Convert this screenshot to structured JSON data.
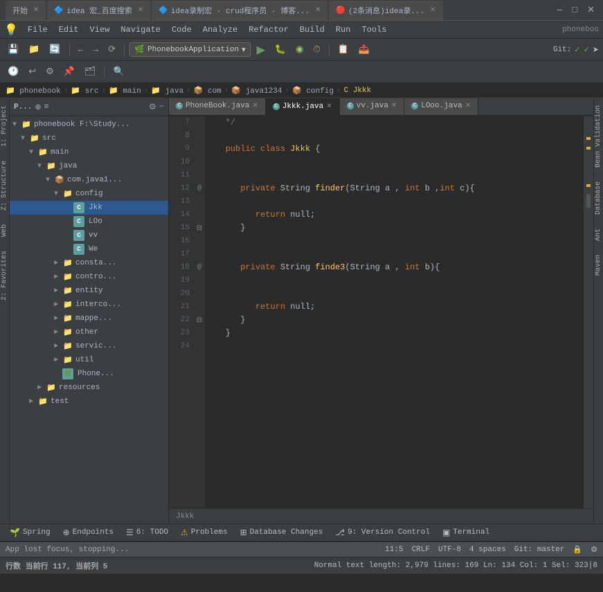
{
  "titlebar": {
    "tabs": [
      {
        "label": "开始",
        "active": false
      },
      {
        "label": "idea 宏_百度搜索",
        "active": false
      },
      {
        "label": "idea录制宏 - crud程序员 - 博客...",
        "active": false
      },
      {
        "label": "(2条消息)idea录...",
        "active": false
      }
    ],
    "controls": [
      "—",
      "□",
      "✕"
    ]
  },
  "menubar": {
    "items": [
      "File",
      "Edit",
      "View",
      "Navigate",
      "Code",
      "Analyze",
      "Refactor",
      "Build",
      "Run",
      "Tools"
    ],
    "appname": "phoneboo"
  },
  "toolbar": {
    "project_dropdown": "PhonebookApplication",
    "git_label": "Git:",
    "git_check": "✓",
    "git_check2": "✓"
  },
  "breadcrumb": {
    "items": [
      "phonebook",
      "src",
      "main",
      "java",
      "com",
      "java1234",
      "config",
      "Jkkk"
    ]
  },
  "project_panel": {
    "title": "P...",
    "tree": [
      {
        "label": "phonebook  F:\\Study...",
        "level": 0,
        "type": "project",
        "expanded": true
      },
      {
        "label": "src",
        "level": 1,
        "type": "folder",
        "expanded": true
      },
      {
        "label": "main",
        "level": 2,
        "type": "folder",
        "expanded": true
      },
      {
        "label": "java",
        "level": 3,
        "type": "folder",
        "expanded": true
      },
      {
        "label": "com.java1...",
        "level": 4,
        "type": "package",
        "expanded": true
      },
      {
        "label": "config",
        "level": 5,
        "type": "folder",
        "expanded": true
      },
      {
        "label": "Jkk",
        "level": 6,
        "type": "java",
        "selected": true
      },
      {
        "label": "LOo",
        "level": 6,
        "type": "java"
      },
      {
        "label": "vv",
        "level": 6,
        "type": "java"
      },
      {
        "label": "We",
        "level": 6,
        "type": "java"
      },
      {
        "label": "consta...",
        "level": 5,
        "type": "folder",
        "collapsed": true
      },
      {
        "label": "contro...",
        "level": 5,
        "type": "folder",
        "collapsed": true
      },
      {
        "label": "entity",
        "level": 5,
        "type": "folder",
        "collapsed": true
      },
      {
        "label": "interco...",
        "level": 5,
        "type": "folder",
        "collapsed": true
      },
      {
        "label": "mappe...",
        "level": 5,
        "type": "folder",
        "collapsed": true
      },
      {
        "label": "other",
        "level": 5,
        "type": "folder",
        "collapsed": true
      },
      {
        "label": "servic...",
        "level": 5,
        "type": "folder",
        "collapsed": true
      },
      {
        "label": "util",
        "level": 5,
        "type": "folder",
        "collapsed": true
      },
      {
        "label": "Phone...",
        "level": 5,
        "type": "java"
      },
      {
        "label": "resources",
        "level": 3,
        "type": "folder",
        "collapsed": true
      },
      {
        "label": "test",
        "level": 2,
        "type": "folder",
        "collapsed": true
      }
    ]
  },
  "editor": {
    "tabs": [
      {
        "label": "PhoneBook.java",
        "active": false
      },
      {
        "label": "Jkkk.java",
        "active": true
      },
      {
        "label": "vv.java",
        "active": false
      },
      {
        "label": "LOoo.java",
        "active": false
      }
    ],
    "filename": "Jkkk",
    "lines": [
      {
        "num": 7,
        "code": "   */",
        "type": "comment"
      },
      {
        "num": 8,
        "code": ""
      },
      {
        "num": 9,
        "code": "   public class Jkkk {",
        "type": "class"
      },
      {
        "num": 10,
        "code": ""
      },
      {
        "num": 11,
        "code": ""
      },
      {
        "num": 12,
        "code": "      private String finder(String a , int b ,int c){",
        "type": "method"
      },
      {
        "num": 13,
        "code": ""
      },
      {
        "num": 14,
        "code": "         return null;",
        "type": "return"
      },
      {
        "num": 15,
        "code": "      }"
      },
      {
        "num": 16,
        "code": ""
      },
      {
        "num": 17,
        "code": ""
      },
      {
        "num": 18,
        "code": "      private String finde3(String a , int b){",
        "type": "method"
      },
      {
        "num": 19,
        "code": ""
      },
      {
        "num": 20,
        "code": ""
      },
      {
        "num": 21,
        "code": "         return null;",
        "type": "return"
      },
      {
        "num": 22,
        "code": "      }"
      },
      {
        "num": 23,
        "code": "   }"
      },
      {
        "num": 24,
        "code": ""
      }
    ]
  },
  "bottom_tabs": [
    {
      "label": "Spring",
      "icon": "🌱"
    },
    {
      "label": "Endpoints",
      "icon": "⊕"
    },
    {
      "label": "6: TODO",
      "icon": "☰"
    },
    {
      "label": "Problems",
      "icon": "⚠",
      "warn": true
    },
    {
      "label": "Database Changes",
      "icon": "⊞"
    },
    {
      "label": "9: Version Control",
      "icon": "⎇"
    },
    {
      "label": "Terminal",
      "icon": "▣"
    }
  ],
  "statusbar": {
    "message": "App lost focus, stopping...",
    "position": "11:5",
    "crlf": "CRLF",
    "encoding": "UTF-8",
    "indent": "4 spaces",
    "git": "Git: master",
    "lock_icon": "🔒"
  },
  "infobar": {
    "left": "行数  当前行 117, 当前列 5",
    "right": "Normal text length: 2,979  lines: 169    Ln: 134   Col: 1   Sel: 323|8"
  },
  "right_panel_labels": [
    "Bean Validation",
    "Database",
    "Ant",
    "Maven"
  ],
  "left_panel_labels": [
    "1: Project",
    "Z: Structure",
    "Web",
    "2: Favorites"
  ]
}
